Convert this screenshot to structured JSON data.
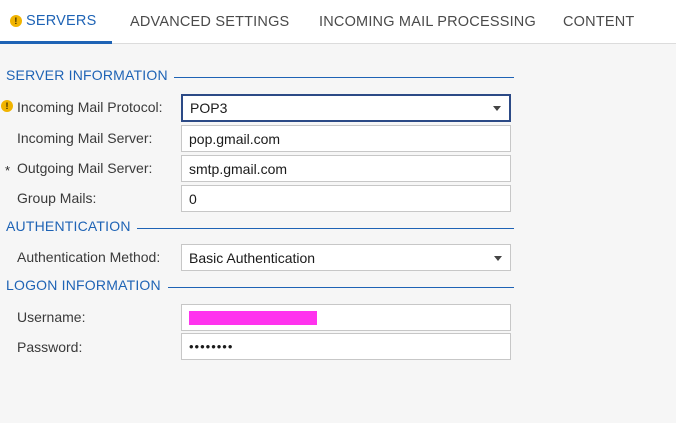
{
  "tabs": [
    {
      "label": "SERVERS",
      "active": true,
      "warning": true
    },
    {
      "label": "ADVANCED SETTINGS"
    },
    {
      "label": "INCOMING MAIL PROCESSING"
    },
    {
      "label": "CONTENT"
    }
  ],
  "sections": {
    "server_information": "SERVER INFORMATION",
    "authentication": "AUTHENTICATION",
    "logon_information": "LOGON INFORMATION"
  },
  "fields": {
    "incoming_mail_protocol": {
      "label": "Incoming Mail Protocol:",
      "value": "POP3"
    },
    "incoming_mail_server": {
      "label": "Incoming Mail Server:",
      "value": "pop.gmail.com"
    },
    "outgoing_mail_server": {
      "label": "Outgoing Mail Server:",
      "value": "smtp.gmail.com",
      "required_marker": "*"
    },
    "group_mails": {
      "label": "Group Mails:",
      "value": "0"
    },
    "authentication_method": {
      "label": "Authentication Method:",
      "value": "Basic Authentication"
    },
    "username": {
      "label": "Username:"
    },
    "password": {
      "label": "Password:",
      "value": "••••••••"
    }
  },
  "icons": {
    "warning": "warning-icon",
    "dropdown": "chevron-down-icon"
  },
  "colors": {
    "accent": "#1e63b5",
    "warning": "#f1b400",
    "redaction": "#ff33ee"
  }
}
